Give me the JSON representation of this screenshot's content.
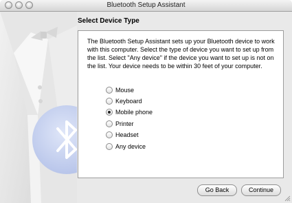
{
  "window": {
    "title": "Bluetooth Setup Assistant"
  },
  "page": {
    "heading": "Select Device Type",
    "description": "The Bluetooth Setup Assistant sets up your Bluetooth device to work with this computer. Select the type of device you want to set up from the list. Select \"Any device\" if the device you want to set up is not on the list. Your device needs to be within 30 feet of your computer."
  },
  "device_types": [
    {
      "label": "Mouse",
      "selected": false
    },
    {
      "label": "Keyboard",
      "selected": false
    },
    {
      "label": "Mobile phone",
      "selected": true
    },
    {
      "label": "Printer",
      "selected": false
    },
    {
      "label": "Headset",
      "selected": false
    },
    {
      "label": "Any device",
      "selected": false
    }
  ],
  "buttons": {
    "back": "Go Back",
    "continue": "Continue"
  },
  "icons": {
    "close": "close-icon",
    "minimize": "minimize-icon",
    "zoom": "zoom-icon",
    "bluetooth": "bluetooth-icon",
    "resize": "resize-grip-icon"
  },
  "colors": {
    "window_bg": "#e9e9e9",
    "panel_bg": "#ffffff",
    "bluetooth_badge": "#c7d2ef"
  }
}
